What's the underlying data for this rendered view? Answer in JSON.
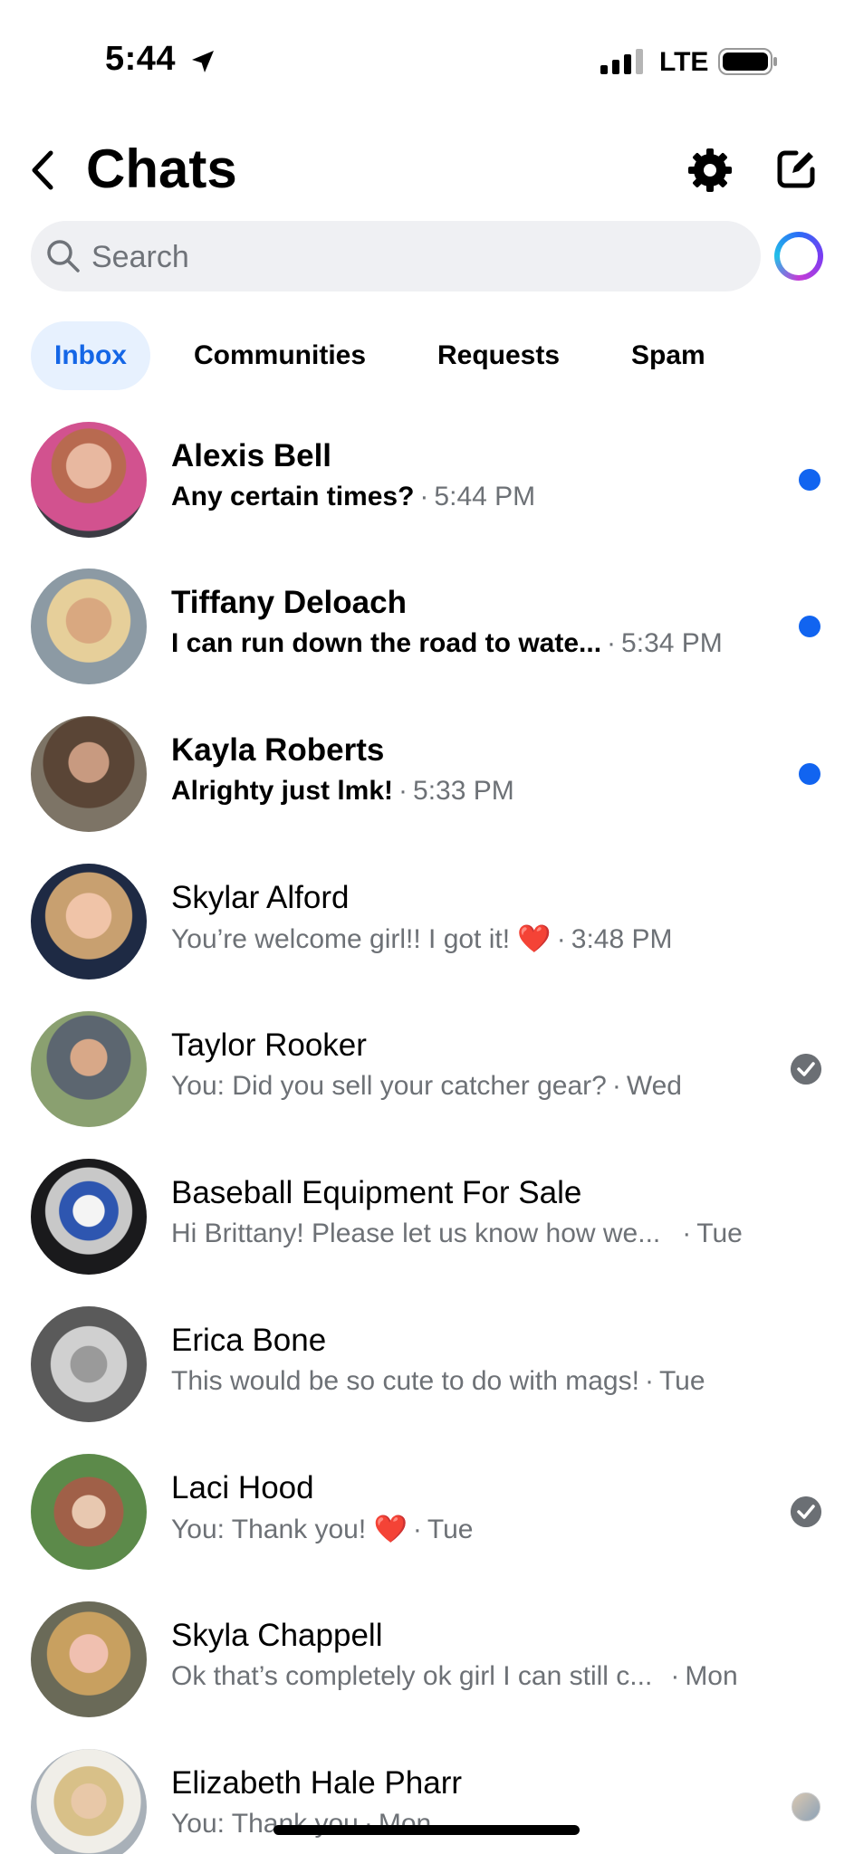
{
  "status_bar": {
    "time": "5:44",
    "network": "LTE"
  },
  "header": {
    "title": "Chats"
  },
  "search": {
    "placeholder": "Search"
  },
  "tabs": [
    {
      "label": "Inbox",
      "active": true
    },
    {
      "label": "Communities",
      "active": false
    },
    {
      "label": "Requests",
      "active": false
    },
    {
      "label": "Spam",
      "active": false
    }
  ],
  "chats": [
    {
      "name": "Alexis Bell",
      "preview": "Any certain times?",
      "time": "5:44 PM",
      "unread": true,
      "status": "unread-dot"
    },
    {
      "name": "Tiffany Deloach",
      "preview": "I can run down the road to wate...",
      "time": "5:34 PM",
      "unread": true,
      "status": "unread-dot"
    },
    {
      "name": "Kayla Roberts",
      "preview": "Alrighty just lmk!",
      "time": "5:33 PM",
      "unread": true,
      "status": "unread-dot"
    },
    {
      "name": "Skylar Alford",
      "preview": "You’re welcome girl!! I got it!",
      "emoji": "❤️",
      "time": "3:48 PM",
      "unread": false,
      "status": "none"
    },
    {
      "name": "Taylor Rooker",
      "preview": "You: Did you sell your catcher gear?",
      "time": "Wed",
      "unread": false,
      "status": "seen-check"
    },
    {
      "name": "Baseball Equipment For Sale",
      "preview": "Hi Brittany! Please let us know how we...",
      "time": "Tue",
      "unread": false,
      "status": "none"
    },
    {
      "name": "Erica Bone",
      "preview": "This would be so cute to do with mags!",
      "time": "Tue",
      "unread": false,
      "status": "none"
    },
    {
      "name": "Laci Hood",
      "preview": "You: Thank you!",
      "emoji": "❤️",
      "time": "Tue",
      "unread": false,
      "status": "seen-check"
    },
    {
      "name": "Skyla Chappell",
      "preview": "Ok that’s completely ok girl I can still c...",
      "time": "Mon",
      "unread": false,
      "status": "none"
    },
    {
      "name": "Elizabeth Hale Pharr",
      "preview": "You: Thank you",
      "time": "Mon",
      "unread": false,
      "status": "seen-avatar"
    }
  ],
  "colors": {
    "accent": "#1164f0",
    "tab_active_bg": "#e7f1fe",
    "muted_text": "#6d7176",
    "search_bg": "#eff0f3"
  }
}
